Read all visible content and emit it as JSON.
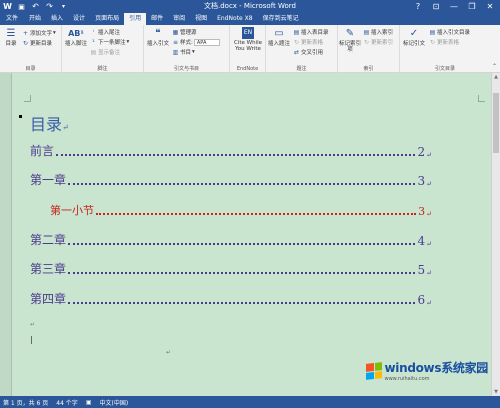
{
  "window": {
    "title": "文档.docx - Microsoft Word",
    "minimize": "—",
    "restore": "❐",
    "close": "✕",
    "word_icon": "W",
    "save_icon": "💾",
    "undo_icon": "↶",
    "redo_icon": "↷"
  },
  "tabs": [
    "文件",
    "开始",
    "插入",
    "设计",
    "页面布局",
    "引用",
    "邮件",
    "审阅",
    "视图",
    "EndNote X8",
    "保存到云笔记"
  ],
  "ribbon": {
    "toc": {
      "label": "目录",
      "group": "目录",
      "add_text": "添加文字",
      "update": "更新目录"
    },
    "footnotes": {
      "insert_footnote": "插入脚注",
      "insert_endnote": "插入尾注",
      "next_footnote": "下一条脚注",
      "show_notes": "显示备注",
      "group": "脚注"
    },
    "citations": {
      "insert_citation": "插入引文",
      "manage_sources": "管理源",
      "style_label": "样式:",
      "style_value": "APA",
      "bibliography": "书目",
      "group": "引文与书目"
    },
    "endnote": {
      "cite": "Cite While You Write",
      "group": "EndNote"
    },
    "captions": {
      "insert_caption": "插入题注",
      "insert_tof": "插入表目录",
      "update_table": "更新表格",
      "cross_ref": "交叉引用",
      "group": "题注"
    },
    "index": {
      "mark_entry": "标记索引项",
      "insert_index": "插入索引",
      "update_index": "更新索引",
      "group": "索引"
    },
    "toa": {
      "mark_citation": "标记引文",
      "insert_toa": "插入引文目录",
      "update_toa": "更新表格",
      "group": "引文目录"
    }
  },
  "document": {
    "title": "目录",
    "entries": [
      {
        "label": "前言",
        "page": "2"
      },
      {
        "label": "第一章",
        "page": "3"
      },
      {
        "label": "第一小节",
        "page": "3"
      },
      {
        "label": "第二章",
        "page": "4"
      },
      {
        "label": "第三章",
        "page": "5"
      },
      {
        "label": "第四章",
        "page": "6"
      }
    ],
    "return_mark": "↵"
  },
  "status": {
    "page": "第 1 页，共 6 页",
    "words": "44 个字",
    "lang": "中文(中国)"
  },
  "watermark": {
    "brand": "windows系统家园",
    "url": "www.ruihaitu.com"
  },
  "colors": {
    "word_blue": "#2b579a",
    "doc_bg": "#c9e5d0",
    "toc_heading": "#3b5ca8",
    "toc_text": "#4d3a8c",
    "toc_sub": "#c8251c"
  }
}
